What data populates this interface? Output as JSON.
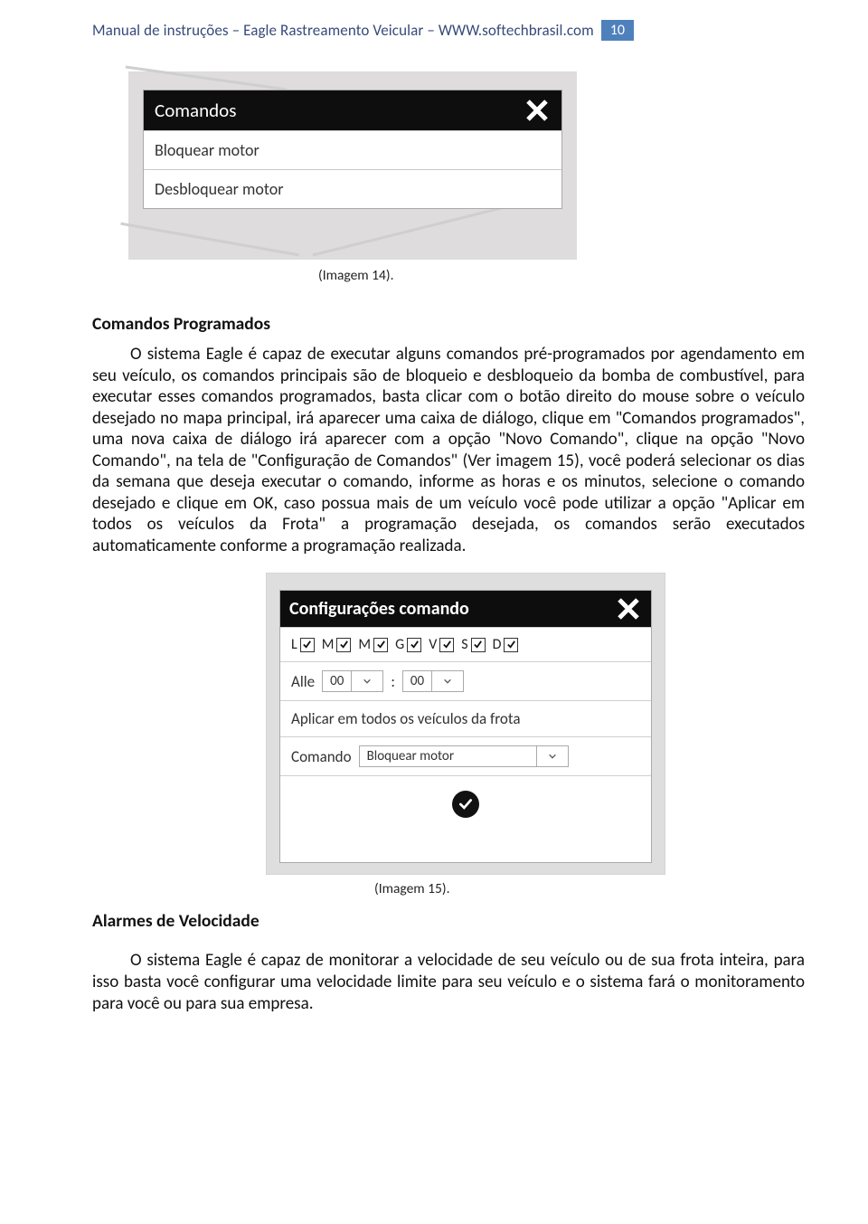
{
  "header": {
    "text": "Manual de instruções – Eagle Rastreamento Veicular – WWW.softechbrasil.com",
    "page_number": "10"
  },
  "image14": {
    "title": "Comandos",
    "rows": [
      "Bloquear motor",
      "Desbloquear motor"
    ],
    "caption": "(Imagem 14)."
  },
  "section1": {
    "heading": "Comandos Programados",
    "paragraph": "O sistema Eagle é capaz de executar alguns comandos pré-programados por agendamento em seu veículo, os comandos principais são de bloqueio e desbloqueio da bomba de combustível, para executar esses comandos programados, basta clicar com o botão direito do mouse sobre o veículo desejado no mapa principal, irá aparecer uma caixa de diálogo, clique em \"Comandos programados\", uma nova caixa de diálogo irá aparecer com a opção \"Novo Comando\", clique na opção \"Novo Comando\", na tela de \"Configuração de Comandos\" (Ver imagem 15), você poderá selecionar os dias da semana que deseja executar o comando, informe as horas e os minutos, selecione o comando desejado e clique em OK, caso possua mais de um veículo você pode utilizar a opção \"Aplicar em todos os veículos da Frota\" a programação desejada, os comandos serão executados automaticamente conforme a programação realizada."
  },
  "image15": {
    "title": "Configurações comando",
    "days": [
      "L",
      "M",
      "M",
      "G",
      "V",
      "S",
      "D"
    ],
    "time_label": "Alle",
    "hour": "00",
    "minute": "00",
    "apply_all": "Aplicar em todos os veículos da frota",
    "command_label": "Comando",
    "command_value": "Bloquear motor",
    "caption": "(Imagem 15)."
  },
  "section2": {
    "heading": "Alarmes de Velocidade",
    "paragraph": "O sistema Eagle é capaz de monitorar a velocidade de seu veículo ou de sua frota inteira, para isso basta você configurar uma velocidade limite para seu veículo e o sistema fará o monitoramento para você ou para sua empresa."
  }
}
